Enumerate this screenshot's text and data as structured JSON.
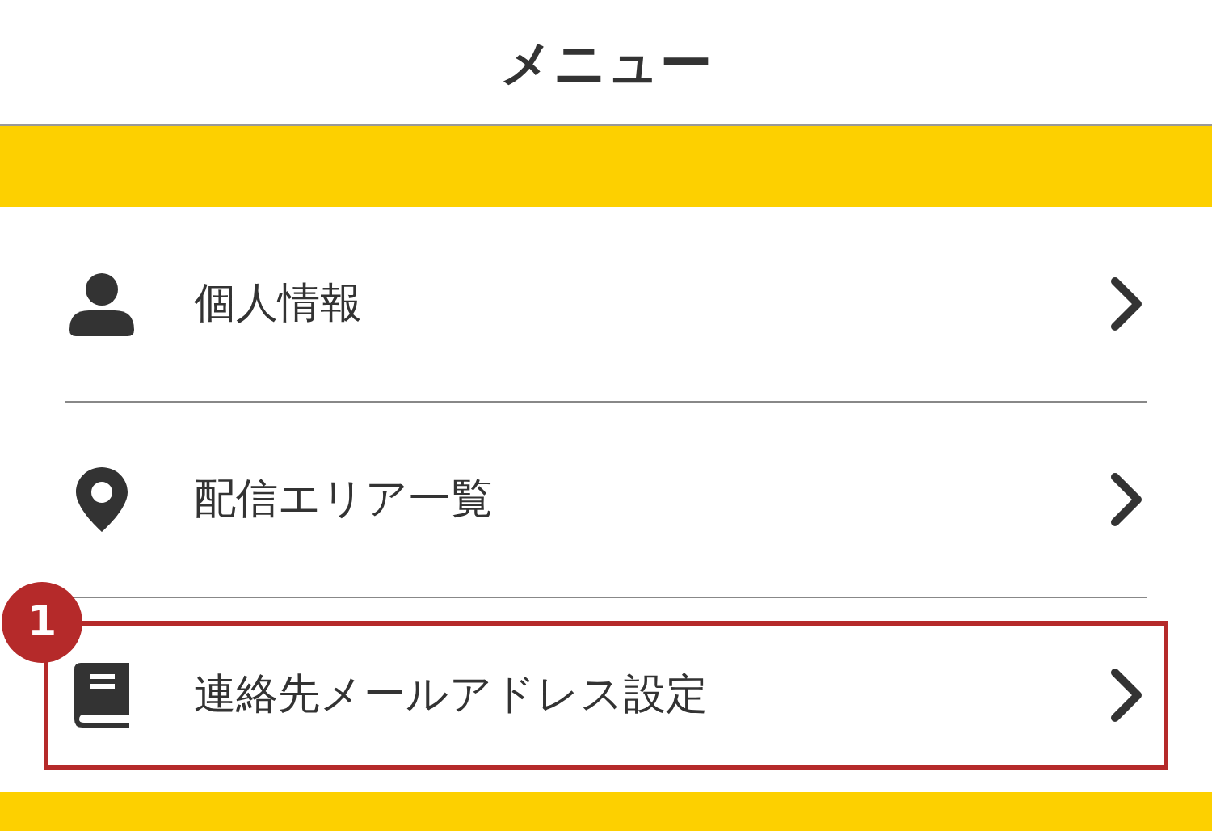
{
  "header": {
    "title": "メニュー"
  },
  "menu_items": [
    {
      "kind": "person",
      "label": "個人情報",
      "highlighted": false
    },
    {
      "kind": "pin",
      "label": "配信エリア一覧",
      "highlighted": false
    },
    {
      "kind": "book",
      "label": "連絡先メールアドレス設定",
      "highlighted": true,
      "badge": "1"
    }
  ]
}
